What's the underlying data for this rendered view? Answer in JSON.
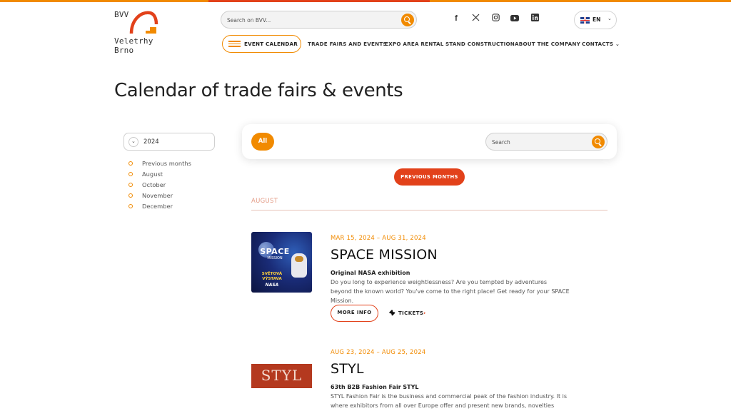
{
  "header": {
    "logo_top": "BVV",
    "logo_name_line1": "Veletrhy",
    "logo_name_line2": "Brno",
    "search_placeholder": "Search on BVV...",
    "social": [
      "facebook-icon",
      "x-icon",
      "instagram-icon",
      "youtube-icon",
      "linkedin-icon"
    ],
    "language": "EN",
    "accent_color": "#f18a00",
    "accent_red": "#e2411a"
  },
  "nav": {
    "event_calendar": "EVENT CALENDAR",
    "items": [
      "TRADE FAIRS AND EVENTS",
      "EXPO AREA RENTAL",
      "STAND CONSTRUCTION",
      "ABOUT THE COMPANY",
      "CONTACTS"
    ]
  },
  "page": {
    "title": "Calendar of trade fairs & events"
  },
  "sidebar": {
    "year": "2024",
    "months": [
      "Previous months",
      "August",
      "October",
      "November",
      "December"
    ]
  },
  "filter": {
    "all_label": "All",
    "search_placeholder": "Search"
  },
  "previous_months_label": "PREVIOUS MONTHS",
  "month_heading": "AUGUST",
  "events": [
    {
      "date": "MAR 15, 2024 – AUG 31, 2024",
      "title": "SPACE MISSION",
      "subtitle": "Original NASA exhibition",
      "description": "Do you long to experience weightlessness? Are you tempted by adventures beyond the known world? You've come to the right place! Get ready for your SPACE Mission.",
      "more_info": "MORE INFO",
      "tickets": "TICKETS",
      "image_text": {
        "line1": "SPACE",
        "line2": "MISSION",
        "line3": "SVĚTOVÁ VÝSTAVA",
        "line4": "NASA"
      }
    },
    {
      "date": "AUG 23, 2024 – AUG 25, 2024",
      "title": "STYL",
      "subtitle": "63th B2B Fashion Fair STYL",
      "description": "STYL Fashion Fair is the business and commercial peak of the fashion industry. It is where exhibitors from all over Europe offer and present new brands, novelties and...",
      "image_text": "STYL"
    }
  ]
}
